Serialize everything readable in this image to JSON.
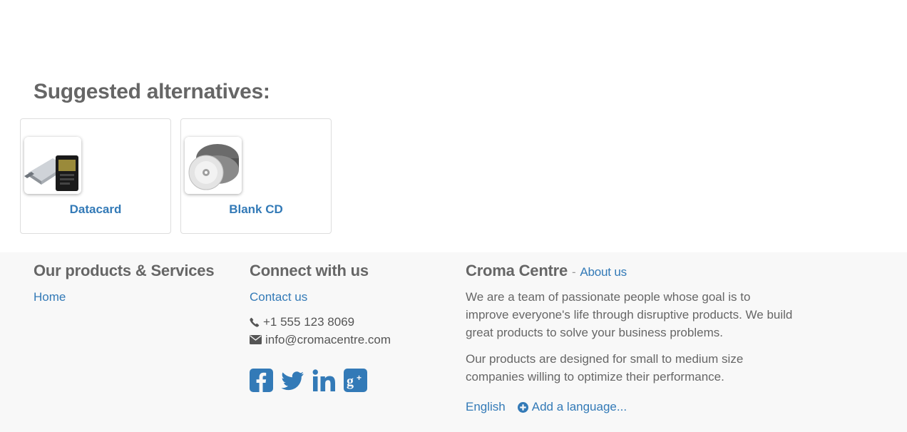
{
  "alternatives": {
    "heading": "Suggested alternatives:",
    "items": [
      {
        "name": "Datacard",
        "image_icon": "usb-datacard-icon"
      },
      {
        "name": "Blank CD",
        "image_icon": "cd-stack-icon"
      }
    ]
  },
  "footer": {
    "products": {
      "heading": "Our products & Services",
      "links": [
        "Home"
      ]
    },
    "connect": {
      "heading": "Connect with us",
      "contact_link": "Contact us",
      "phone": "+1 555 123 8069",
      "email": "info@cromacentre.com",
      "social": [
        "facebook-icon",
        "twitter-icon",
        "linkedin-icon",
        "google-plus-icon"
      ]
    },
    "about": {
      "company": "Croma Centre",
      "separator": "-",
      "about_link": "About us",
      "para1": "We are a team of passionate people whose goal is to improve everyone's life through disruptive products. We build great products to solve your business problems.",
      "para2": "Our products are designed for small to medium size companies willing to optimize their performance.",
      "language": "English",
      "add_language": "Add a language..."
    }
  },
  "colors": {
    "link": "#337ab7",
    "text": "#666666",
    "footer_bg": "#f8f8f8",
    "card_border": "#dddddd"
  }
}
